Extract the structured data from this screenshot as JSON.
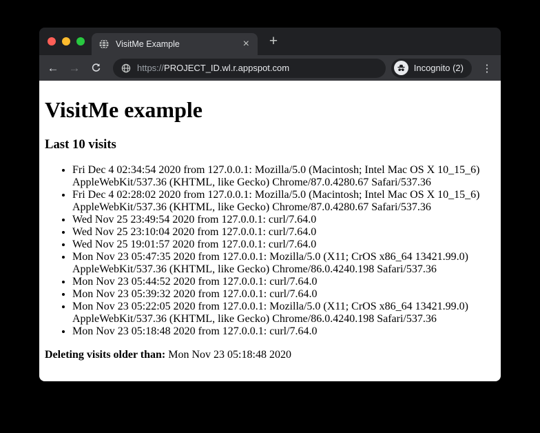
{
  "browser": {
    "window_controls": {
      "close": "close",
      "minimize": "minimize",
      "zoom": "zoom"
    },
    "tab": {
      "title": "VisitMe Example",
      "favicon": "globe-icon",
      "close_icon": "×",
      "new_tab_icon": "+"
    },
    "toolbar": {
      "back_icon": "←",
      "forward_icon": "→",
      "reload_icon": "reload-icon",
      "url_scheme": "https://",
      "url_host": "PROJECT_ID.wl.r.appspot.com",
      "site_icon": "globe-icon",
      "incognito_icon": "incognito-icon",
      "incognito_label": "Incognito (2)",
      "menu_icon": "⋮"
    },
    "colors": {
      "frame": "#202124",
      "toolbar": "#35363a",
      "omnibox": "#202124",
      "text": "#e8eaed",
      "muted_text": "#9aa0a6",
      "traffic_red": "#ff5f57",
      "traffic_yellow": "#febc2e",
      "traffic_green": "#28c840"
    }
  },
  "page": {
    "title": "VisitMe example",
    "section_heading": "Last 10 visits",
    "visits": [
      "Fri Dec 4 02:34:54 2020 from 127.0.0.1: Mozilla/5.0 (Macintosh; Intel Mac OS X 10_15_6) AppleWebKit/537.36 (KHTML, like Gecko) Chrome/87.0.4280.67 Safari/537.36",
      "Fri Dec 4 02:28:02 2020 from 127.0.0.1: Mozilla/5.0 (Macintosh; Intel Mac OS X 10_15_6) AppleWebKit/537.36 (KHTML, like Gecko) Chrome/87.0.4280.67 Safari/537.36",
      "Wed Nov 25 23:49:54 2020 from 127.0.0.1: curl/7.64.0",
      "Wed Nov 25 23:10:04 2020 from 127.0.0.1: curl/7.64.0",
      "Wed Nov 25 19:01:57 2020 from 127.0.0.1: curl/7.64.0",
      "Mon Nov 23 05:47:35 2020 from 127.0.0.1: Mozilla/5.0 (X11; CrOS x86_64 13421.99.0) AppleWebKit/537.36 (KHTML, like Gecko) Chrome/86.0.4240.198 Safari/537.36",
      "Mon Nov 23 05:44:52 2020 from 127.0.0.1: curl/7.64.0",
      "Mon Nov 23 05:39:32 2020 from 127.0.0.1: curl/7.64.0",
      "Mon Nov 23 05:22:05 2020 from 127.0.0.1: Mozilla/5.0 (X11; CrOS x86_64 13421.99.0) AppleWebKit/537.36 (KHTML, like Gecko) Chrome/86.0.4240.198 Safari/537.36",
      "Mon Nov 23 05:18:48 2020 from 127.0.0.1: curl/7.64.0"
    ],
    "footer": {
      "label": "Deleting visits older than:",
      "value": "Mon Nov 23 05:18:48 2020"
    }
  }
}
